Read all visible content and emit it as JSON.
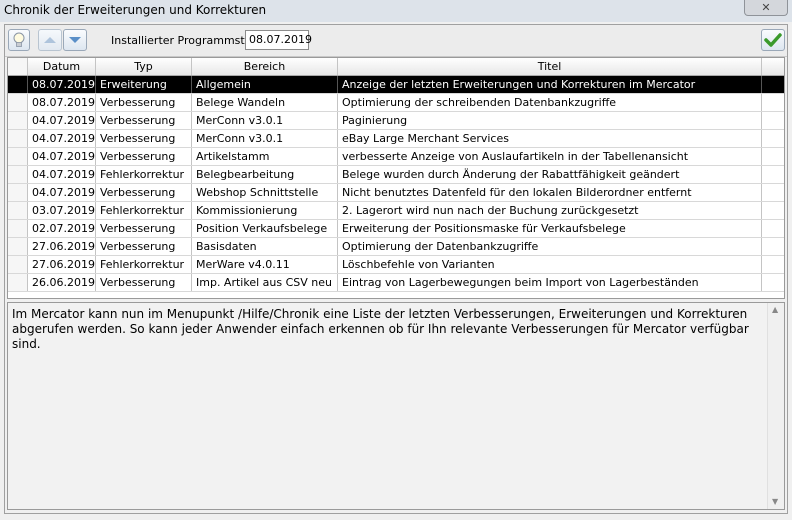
{
  "window": {
    "title": "Chronik der Erweiterungen und Korrekturen",
    "close_glyph": "✕"
  },
  "toolbar": {
    "label": "Installierter Programmstand:",
    "version_value": "08.07.2019"
  },
  "icons": {
    "bulb": "lightbulb-icon",
    "up": "arrow-up-icon",
    "down": "arrow-down-icon",
    "confirm": "checkmark-icon"
  },
  "colors": {
    "selected_row": "#000000",
    "check_green": "#3a9a2c"
  },
  "table": {
    "columns": [
      "Datum",
      "Typ",
      "Bereich",
      "Titel"
    ],
    "rows": [
      {
        "datum": "08.07.2019",
        "typ": "Erweiterung",
        "bereich": "Allgemein",
        "titel": "Anzeige der letzten Erweiterungen und Korrekturen im Mercator",
        "selected": true
      },
      {
        "datum": "08.07.2019",
        "typ": "Verbesserung",
        "bereich": "Belege Wandeln",
        "titel": "Optimierung der schreibenden Datenbankzugriffe"
      },
      {
        "datum": "04.07.2019",
        "typ": "Verbesserung",
        "bereich": "MerConn v3.0.1",
        "titel": "Paginierung"
      },
      {
        "datum": "04.07.2019",
        "typ": "Verbesserung",
        "bereich": "MerConn v3.0.1",
        "titel": "eBay Large Merchant Services"
      },
      {
        "datum": "04.07.2019",
        "typ": "Verbesserung",
        "bereich": "Artikelstamm",
        "titel": "verbesserte Anzeige von Auslaufartikeln in der Tabellenansicht"
      },
      {
        "datum": "04.07.2019",
        "typ": "Fehlerkorrektur",
        "bereich": "Belegbearbeitung",
        "titel": "Belege wurden durch Änderung der Rabattfähigkeit geändert"
      },
      {
        "datum": "04.07.2019",
        "typ": "Verbesserung",
        "bereich": "Webshop Schnittstelle",
        "titel": "Nicht benutztes Datenfeld für den lokalen Bilderordner entfernt"
      },
      {
        "datum": "03.07.2019",
        "typ": "Fehlerkorrektur",
        "bereich": "Kommissionierung",
        "titel": "2. Lagerort wird nun nach der Buchung zurückgesetzt"
      },
      {
        "datum": "02.07.2019",
        "typ": "Verbesserung",
        "bereich": "Position Verkaufsbelege",
        "titel": "Erweiterung der Positionsmaske für Verkaufsbelege"
      },
      {
        "datum": "27.06.2019",
        "typ": "Verbesserung",
        "bereich": "Basisdaten",
        "titel": "Optimierung der Datenbankzugriffe"
      },
      {
        "datum": "27.06.2019",
        "typ": "Fehlerkorrektur",
        "bereich": "MerWare v4.0.11",
        "titel": "Löschbefehle von Varianten"
      },
      {
        "datum": "26.06.2019",
        "typ": "Verbesserung",
        "bereich": "Imp. Artikel aus CSV neu",
        "titel": "Eintrag von Lagerbewegungen beim Import von Lagerbeständen"
      }
    ]
  },
  "notes": {
    "text": "Im Mercator kann nun im Menupunkt /Hilfe/Chronik eine Liste der letzten Verbesserungen, Erweiterungen und Korrekturen abgerufen werden. So kann jeder Anwender einfach erkennen ob für Ihn relevante Verbesserungen für Mercator verfügbar sind."
  }
}
